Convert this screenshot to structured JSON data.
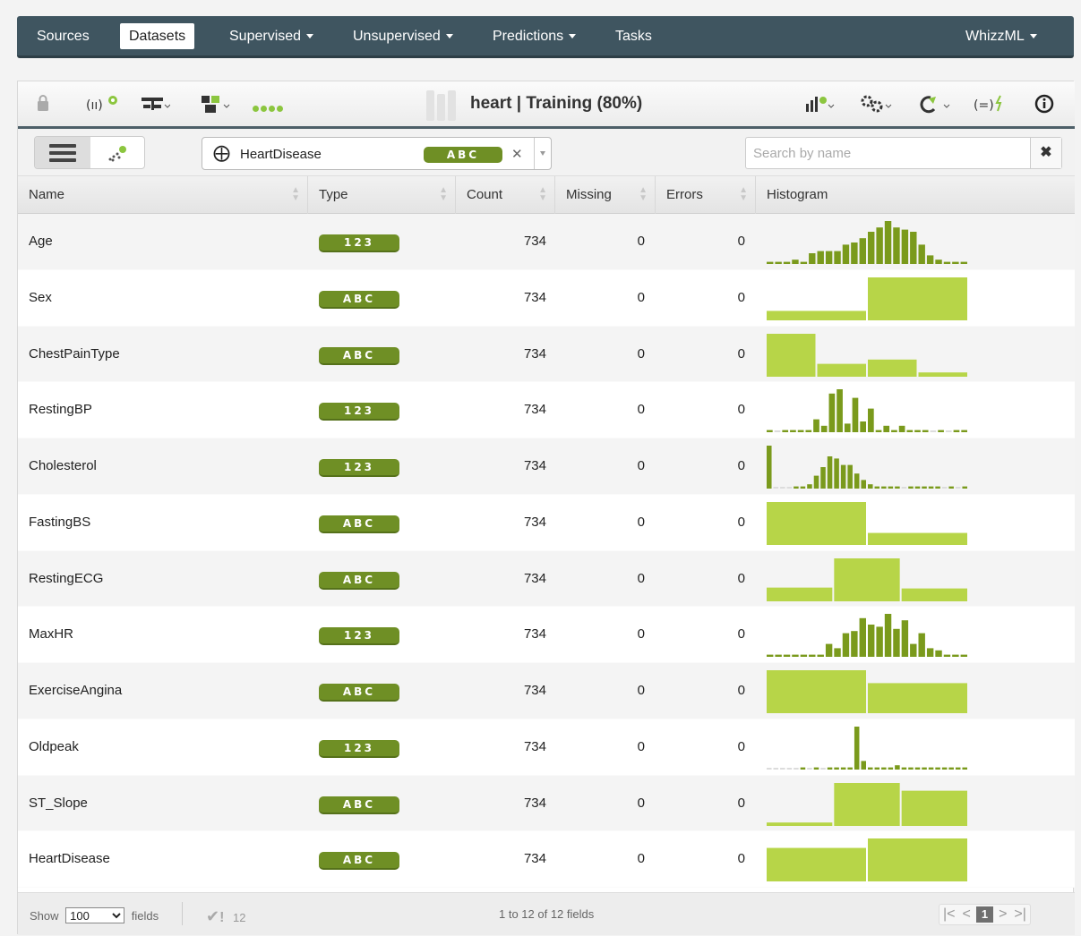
{
  "nav": {
    "items": [
      {
        "label": "Sources",
        "active": false,
        "dropdown": false
      },
      {
        "label": "Datasets",
        "active": true,
        "dropdown": false
      },
      {
        "label": "Supervised",
        "active": false,
        "dropdown": true
      },
      {
        "label": "Unsupervised",
        "active": false,
        "dropdown": true
      },
      {
        "label": "Predictions",
        "active": false,
        "dropdown": true
      },
      {
        "label": "Tasks",
        "active": false,
        "dropdown": false
      }
    ],
    "right_item": {
      "label": "WhizzML",
      "dropdown": true
    }
  },
  "toolbar": {
    "title": "heart | Training (80%)",
    "left_icons": [
      "lock-icon",
      "sample-icon",
      "split-icon",
      "filter-icon",
      "status-dots-icon"
    ],
    "right_icons": [
      "model-icon",
      "configure-icon",
      "batch-icon",
      "formula-icon",
      "info-icon"
    ]
  },
  "filterbar": {
    "objective_field": "HeartDisease",
    "objective_type": "ABC",
    "search_placeholder": "Search by name"
  },
  "table": {
    "columns": [
      "Name",
      "Type",
      "Count",
      "Missing",
      "Errors",
      "Histogram"
    ],
    "rows": [
      {
        "name": "Age",
        "type": "123",
        "count": "734",
        "missing": "0",
        "errors": "0",
        "hist": {
          "kind": "numeric",
          "bars": [
            0.05,
            0.05,
            0.05,
            0.1,
            0.05,
            0.25,
            0.3,
            0.3,
            0.3,
            0.45,
            0.5,
            0.6,
            0.75,
            0.85,
            1.0,
            0.85,
            0.8,
            0.75,
            0.45,
            0.2,
            0.1,
            0.05,
            0.05,
            0.05
          ]
        }
      },
      {
        "name": "Sex",
        "type": "ABC",
        "count": "734",
        "missing": "0",
        "errors": "0",
        "hist": {
          "kind": "categorical",
          "bars": [
            0.22,
            1.0
          ]
        }
      },
      {
        "name": "ChestPainType",
        "type": "ABC",
        "count": "734",
        "missing": "0",
        "errors": "0",
        "hist": {
          "kind": "categorical",
          "bars": [
            1.0,
            0.3,
            0.4,
            0.1
          ]
        }
      },
      {
        "name": "RestingBP",
        "type": "123",
        "count": "734",
        "missing": "0",
        "errors": "0",
        "hist": {
          "kind": "numeric",
          "bars": [
            0.05,
            0,
            0.05,
            0.05,
            0.05,
            0.05,
            0.3,
            0.15,
            0.9,
            1.0,
            0.2,
            0.8,
            0.25,
            0.55,
            0.05,
            0.15,
            0.05,
            0.15,
            0.05,
            0.05,
            0.05,
            0,
            0.05,
            0,
            0.05,
            0.05
          ]
        }
      },
      {
        "name": "Cholesterol",
        "type": "123",
        "count": "734",
        "missing": "0",
        "errors": "0",
        "hist": {
          "kind": "numeric",
          "bars": [
            1.0,
            0,
            0,
            0,
            0.05,
            0.05,
            0.1,
            0.3,
            0.5,
            0.75,
            0.7,
            0.55,
            0.55,
            0.35,
            0.2,
            0.1,
            0.05,
            0.05,
            0.05,
            0.05,
            0,
            0.05,
            0.05,
            0.05,
            0.05,
            0.05,
            0,
            0.05,
            0,
            0.05
          ]
        }
      },
      {
        "name": "FastingBS",
        "type": "ABC",
        "count": "734",
        "missing": "0",
        "errors": "0",
        "hist": {
          "kind": "categorical",
          "bars": [
            1.0,
            0.28
          ]
        }
      },
      {
        "name": "RestingECG",
        "type": "ABC",
        "count": "734",
        "missing": "0",
        "errors": "0",
        "hist": {
          "kind": "categorical",
          "bars": [
            0.32,
            1.0,
            0.3
          ]
        }
      },
      {
        "name": "MaxHR",
        "type": "123",
        "count": "734",
        "missing": "0",
        "errors": "0",
        "hist": {
          "kind": "numeric",
          "bars": [
            0.05,
            0.05,
            0.05,
            0.05,
            0.05,
            0.05,
            0.05,
            0.3,
            0.2,
            0.55,
            0.6,
            0.9,
            0.75,
            0.7,
            1.0,
            0.65,
            0.85,
            0.3,
            0.55,
            0.2,
            0.15,
            0.05,
            0.05,
            0.05
          ]
        }
      },
      {
        "name": "ExerciseAngina",
        "type": "ABC",
        "count": "734",
        "missing": "0",
        "errors": "0",
        "hist": {
          "kind": "categorical",
          "bars": [
            1.0,
            0.7
          ]
        }
      },
      {
        "name": "Oldpeak",
        "type": "123",
        "count": "734",
        "missing": "0",
        "errors": "0",
        "hist": {
          "kind": "numeric",
          "bars": [
            0,
            0,
            0,
            0,
            0,
            0.05,
            0,
            0.05,
            0,
            0.05,
            0.05,
            0.05,
            0.05,
            1.0,
            0.2,
            0.05,
            0.05,
            0.05,
            0.05,
            0.1,
            0.05,
            0.05,
            0.05,
            0.05,
            0.05,
            0.05,
            0.05,
            0.05,
            0.05,
            0.05
          ]
        }
      },
      {
        "name": "ST_Slope",
        "type": "ABC",
        "count": "734",
        "missing": "0",
        "errors": "0",
        "hist": {
          "kind": "categorical",
          "bars": [
            0.08,
            1.0,
            0.82
          ]
        }
      },
      {
        "name": "HeartDisease",
        "type": "ABC",
        "count": "734",
        "missing": "0",
        "errors": "0",
        "hist": {
          "kind": "categorical",
          "bars": [
            0.78,
            1.0
          ]
        }
      }
    ]
  },
  "footer": {
    "show_label": "Show",
    "show_value": "100",
    "fields_label": "fields",
    "valid_count": "12",
    "range_text": "1 to 12 of 12 fields",
    "current_page": "1"
  },
  "colors": {
    "nav_bg": "#3f5560",
    "badge_green": "#6f8f25",
    "hist_numeric": "#7a9a1c",
    "hist_categorical": "#b7d548"
  }
}
